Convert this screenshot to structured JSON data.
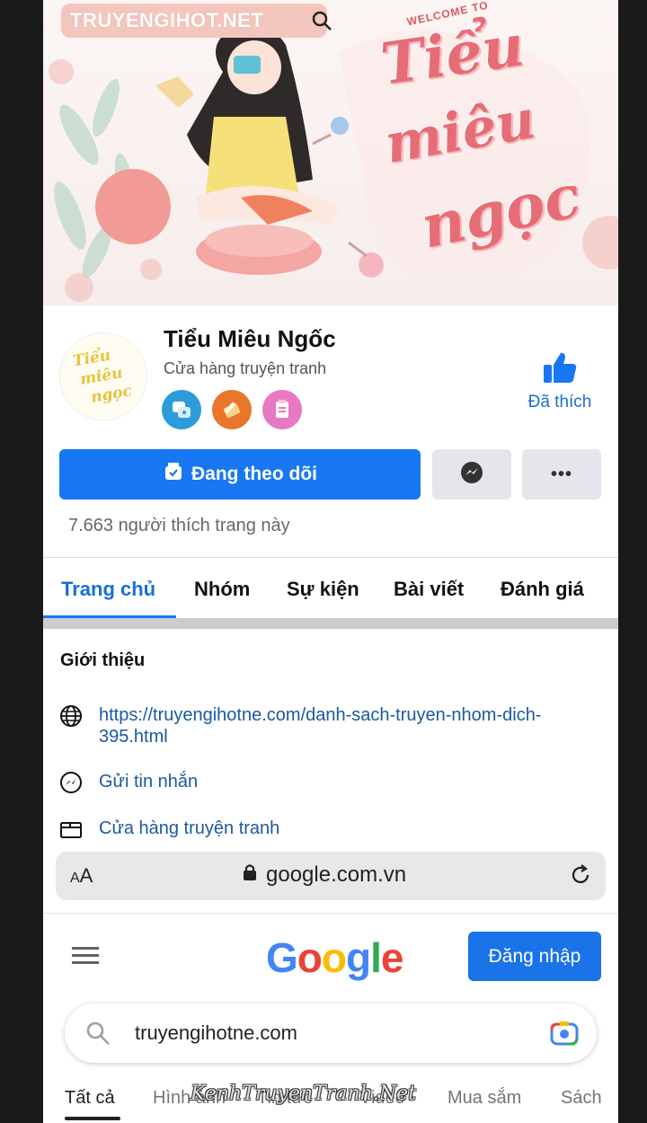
{
  "cover": {
    "watermark": "TRUYENGIHOT.NET",
    "welcome": "WELCOME TO",
    "script_line1": "Tiểu",
    "script_line2": "miêu",
    "script_line3": "ngọc"
  },
  "profile": {
    "name": "Tiểu Miêu Ngốc",
    "category": "Cửa hàng truyện tranh",
    "avatar_line1": "Tiểu",
    "avatar_line2": "miêu",
    "avatar_line3": "ngọc",
    "liked_label": "Đã thích",
    "follow_label": "Đang theo dõi",
    "more_label": "•••",
    "likes_text": "7.663 người thích trang này"
  },
  "tabs": {
    "items": [
      "Trang chủ",
      "Nhóm",
      "Sự kiện",
      "Bài viết",
      "Đánh giá"
    ],
    "active": "Trang chủ"
  },
  "intro": {
    "title": "Giới thiệu",
    "website": "https://truyengihotne.com/danh-sach-truyen-nhom-dich-395.html",
    "message": "Gửi tin nhắn",
    "category": "Cửa hàng truyện tranh"
  },
  "browser": {
    "aa_small": "A",
    "aa_large": "A",
    "url": "google.com.vn"
  },
  "google": {
    "logo": [
      "G",
      "o",
      "o",
      "g",
      "l",
      "e"
    ],
    "login": "Đăng nhập",
    "query": "truyengihotne.com",
    "tabs": [
      "Tất cả",
      "Hình ảnh",
      "Tin tức",
      "Video",
      "Mua sắm",
      "Sách"
    ],
    "active_tab": "Tất cả",
    "watermark": "KenhTruyenTranh.Net"
  },
  "colors": {
    "facebook_blue": "#1877f2",
    "link_blue": "#1a5aa0",
    "google_blue": "#4285f4",
    "google_red": "#ea4335",
    "google_yellow": "#fbbc05",
    "google_green": "#34a853"
  }
}
